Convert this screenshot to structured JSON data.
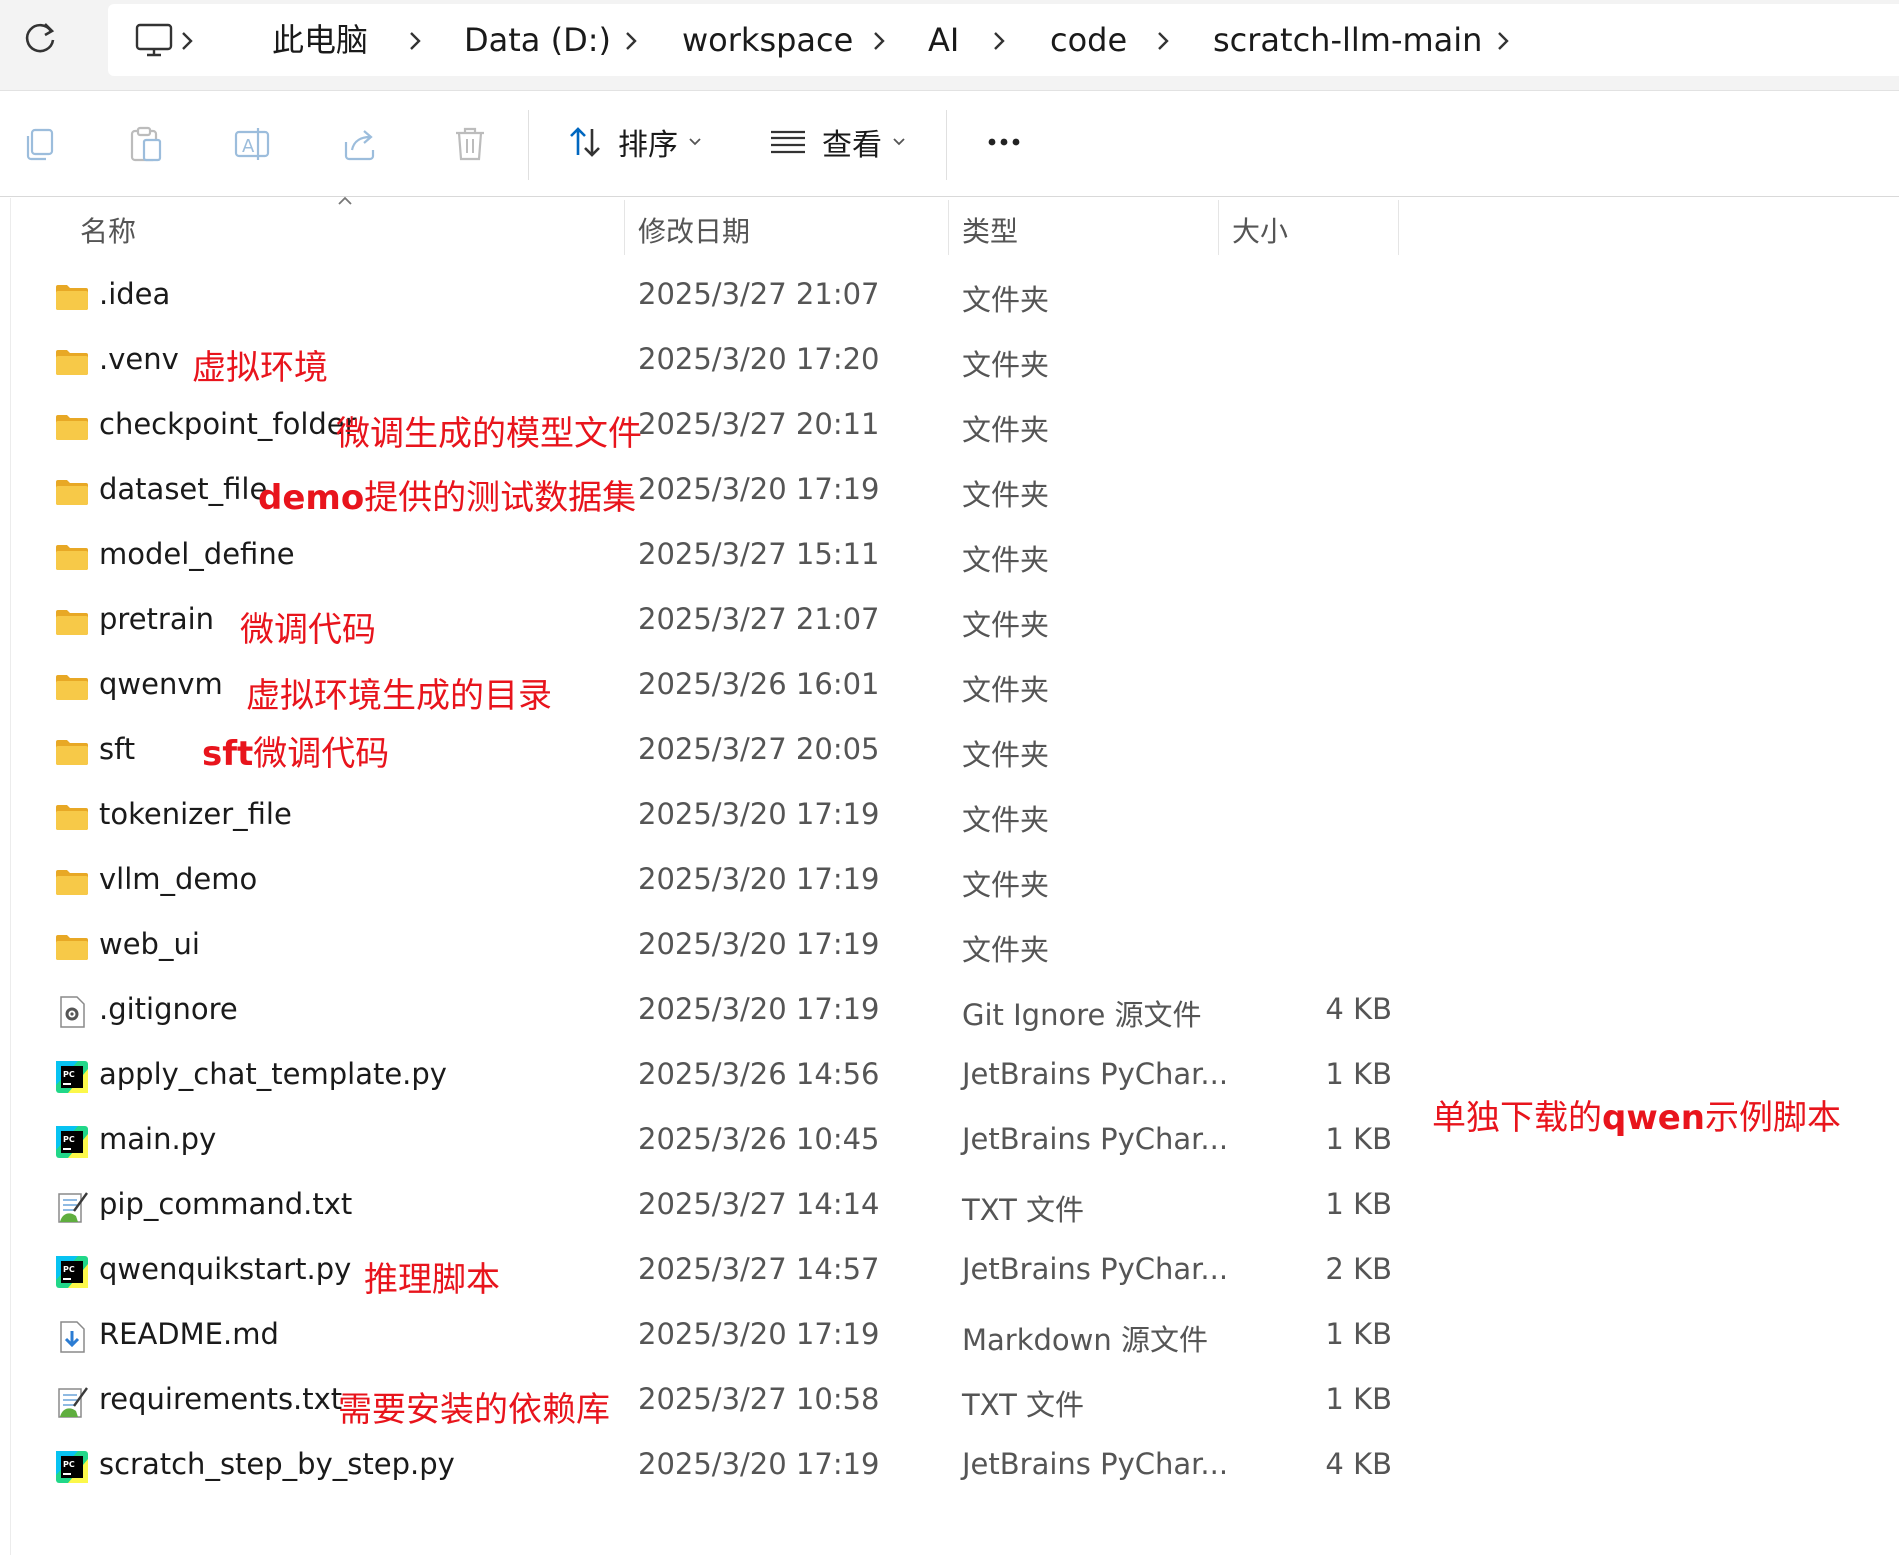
{
  "address_bar": {
    "crumbs": [
      "此电脑",
      "Data (D:)",
      "workspace",
      "AI",
      "code",
      "scratch-llm-main"
    ]
  },
  "toolbar": {
    "sort_label": "排序",
    "view_label": "查看"
  },
  "columns": {
    "name": "名称",
    "date": "修改日期",
    "type": "类型",
    "size": "大小"
  },
  "files": [
    {
      "name": ".idea",
      "date": "2025/3/27 21:07",
      "type": "文件夹",
      "size": "",
      "icon": "folder-icon"
    },
    {
      "name": ".venv",
      "date": "2025/3/20 17:20",
      "type": "文件夹",
      "size": "",
      "icon": "folder-icon"
    },
    {
      "name": "checkpoint_folder",
      "date": "2025/3/27 20:11",
      "type": "文件夹",
      "size": "",
      "icon": "folder-icon"
    },
    {
      "name": "dataset_file",
      "date": "2025/3/20 17:19",
      "type": "文件夹",
      "size": "",
      "icon": "folder-icon"
    },
    {
      "name": "model_define",
      "date": "2025/3/27 15:11",
      "type": "文件夹",
      "size": "",
      "icon": "folder-icon"
    },
    {
      "name": "pretrain",
      "date": "2025/3/27 21:07",
      "type": "文件夹",
      "size": "",
      "icon": "folder-icon"
    },
    {
      "name": "qwenvm",
      "date": "2025/3/26 16:01",
      "type": "文件夹",
      "size": "",
      "icon": "folder-icon"
    },
    {
      "name": "sft",
      "date": "2025/3/27 20:05",
      "type": "文件夹",
      "size": "",
      "icon": "folder-icon"
    },
    {
      "name": "tokenizer_file",
      "date": "2025/3/20 17:19",
      "type": "文件夹",
      "size": "",
      "icon": "folder-icon"
    },
    {
      "name": "vllm_demo",
      "date": "2025/3/20 17:19",
      "type": "文件夹",
      "size": "",
      "icon": "folder-icon"
    },
    {
      "name": "web_ui",
      "date": "2025/3/20 17:19",
      "type": "文件夹",
      "size": "",
      "icon": "folder-icon"
    },
    {
      "name": ".gitignore",
      "date": "2025/3/20 17:19",
      "type": "Git Ignore 源文件",
      "size": "4 KB",
      "icon": "settings-file-icon"
    },
    {
      "name": "apply_chat_template.py",
      "date": "2025/3/26 14:56",
      "type": "JetBrains PyChar...",
      "size": "1 KB",
      "icon": "pycharm-icon"
    },
    {
      "name": "main.py",
      "date": "2025/3/26 10:45",
      "type": "JetBrains PyChar...",
      "size": "1 KB",
      "icon": "pycharm-icon"
    },
    {
      "name": "pip_command.txt",
      "date": "2025/3/27 14:14",
      "type": "TXT 文件",
      "size": "1 KB",
      "icon": "text-file-icon"
    },
    {
      "name": "qwenquikstart.py",
      "date": "2025/3/27 14:57",
      "type": "JetBrains PyChar...",
      "size": "2 KB",
      "icon": "pycharm-icon"
    },
    {
      "name": "README.md",
      "date": "2025/3/20 17:19",
      "type": "Markdown 源文件",
      "size": "1 KB",
      "icon": "markdown-file-icon"
    },
    {
      "name": "requirements.txt",
      "date": "2025/3/27 10:58",
      "type": "TXT 文件",
      "size": "1 KB",
      "icon": "text-file-icon"
    },
    {
      "name": "scratch_step_by_step.py",
      "date": "2025/3/20 17:19",
      "type": "JetBrains PyChar...",
      "size": "4 KB",
      "icon": "pycharm-icon"
    }
  ],
  "annotations": {
    "venv": "虚拟环境",
    "checkpoint": "微调生成的模型文件",
    "dataset_bold": "demo",
    "dataset_rest": "提供的测试数据集",
    "pretrain": "微调代码",
    "qwenvm": "虚拟环境生成的目录",
    "sft_bold": "sft",
    "sft_rest": "微调代码",
    "qwen_pre": "单独下载的",
    "qwen_bold": "qwen",
    "qwen_post": "示例脚本",
    "quickstart": "推理脚本",
    "requirements": "需要安装的依赖库"
  },
  "colors": {
    "annotation": "#e8141c",
    "folder": "#f7c948",
    "accent": "#0067c0"
  }
}
